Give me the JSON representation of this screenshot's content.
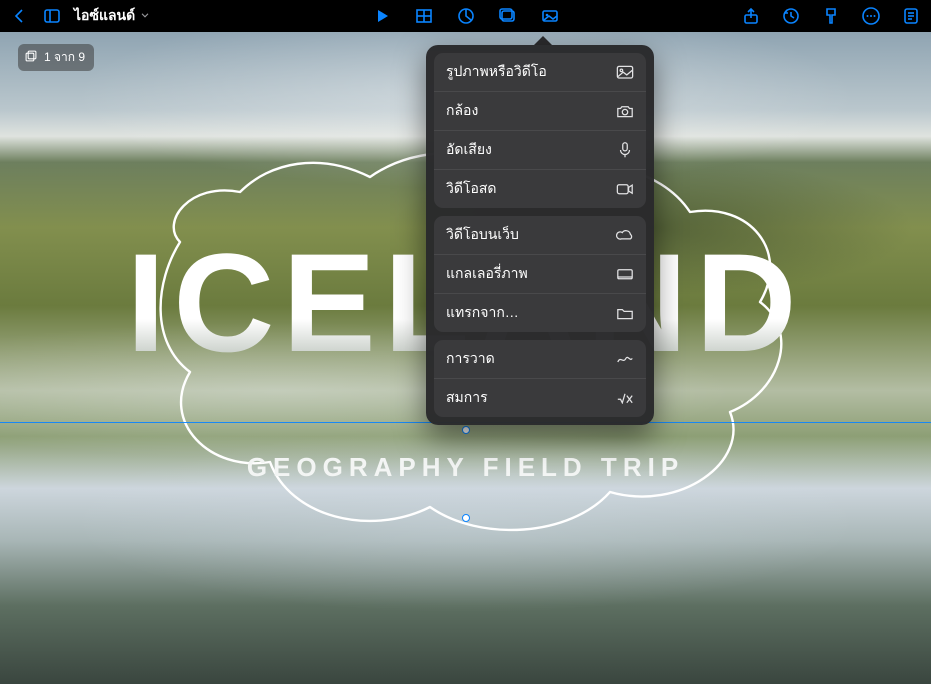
{
  "accent": "#0a84ff",
  "toolbar": {
    "doc_title": "ไอซ์แลนด์"
  },
  "slide": {
    "counter": "1 จาก 9",
    "title": "ICELAND",
    "subtitle": "GEOGRAPHY FIELD TRIP"
  },
  "insert_menu": {
    "groups": [
      {
        "items": [
          {
            "label": "รูปภาพหรือวิดีโอ",
            "icon": "photo-video-icon"
          },
          {
            "label": "กล้อง",
            "icon": "camera-icon"
          },
          {
            "label": "อัดเสียง",
            "icon": "microphone-icon"
          },
          {
            "label": "วิดีโอสด",
            "icon": "live-video-icon"
          }
        ]
      },
      {
        "items": [
          {
            "label": "วิดีโอบนเว็บ",
            "icon": "cloud-icon"
          },
          {
            "label": "แกลเลอรี่ภาพ",
            "icon": "gallery-icon"
          },
          {
            "label": "แทรกจาก…",
            "icon": "folder-icon"
          }
        ]
      },
      {
        "items": [
          {
            "label": "การวาด",
            "icon": "scribble-icon"
          },
          {
            "label": "สมการ",
            "icon": "equation-icon"
          }
        ]
      }
    ]
  }
}
